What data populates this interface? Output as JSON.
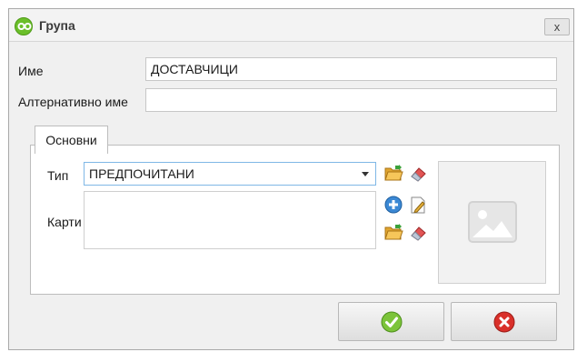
{
  "window": {
    "title": "Група",
    "close_label": "x"
  },
  "form": {
    "name_label": "Име",
    "name_value": "ДОСТАВЧИЦИ",
    "alt_name_label": "Алтернативно име",
    "alt_name_value": ""
  },
  "tabs": [
    {
      "label": "Основни",
      "active": true
    }
  ],
  "main": {
    "type_label": "Тип",
    "type_value": "ПРЕДПОЧИТАНИ",
    "cards_label": "Карти"
  },
  "icons": {
    "app": "app-logo-icon",
    "open_folder": "open-folder-icon",
    "eraser": "eraser-icon",
    "add": "add-icon",
    "edit": "edit-icon",
    "image_placeholder": "image-placeholder-icon",
    "ok": "checkmark-icon",
    "cancel": "cancel-icon"
  },
  "colors": {
    "accent_green": "#6bbf2a",
    "cancel_red": "#d9302a",
    "focus_border": "#7fb7e6"
  }
}
